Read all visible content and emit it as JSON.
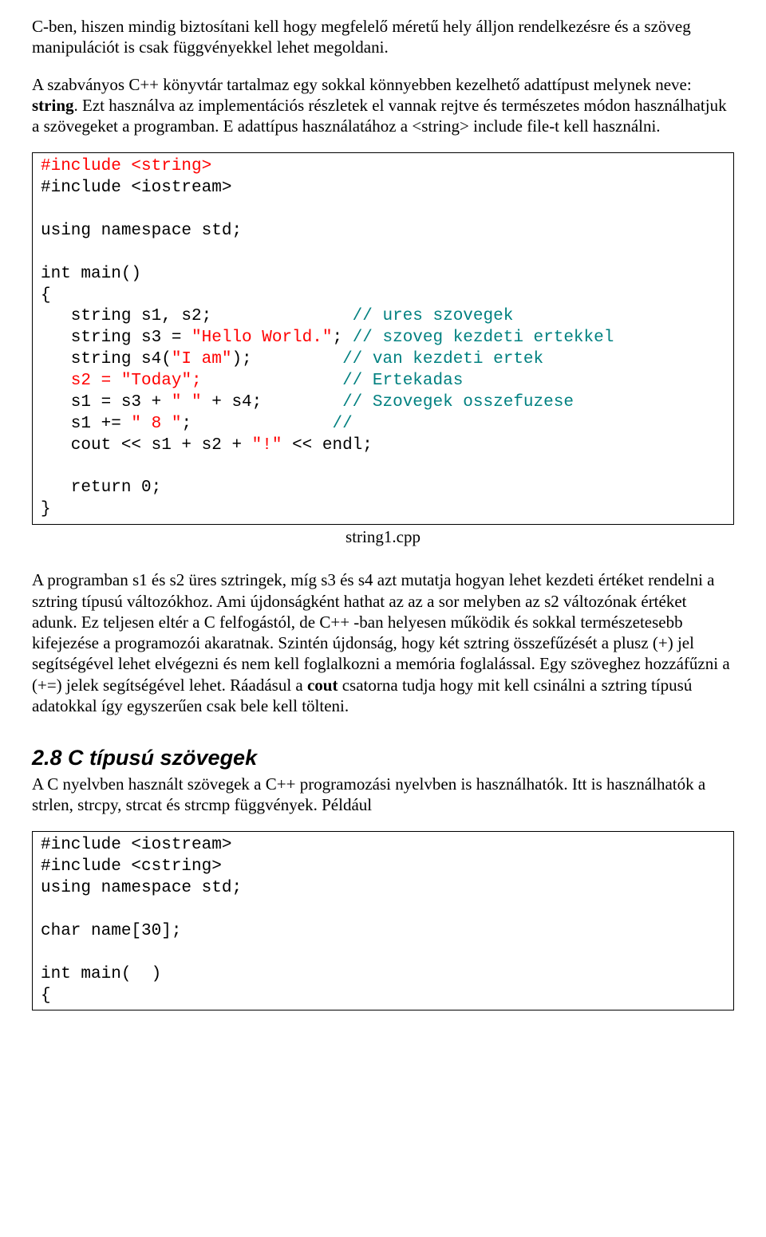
{
  "para1": "C-ben, hiszen mindig biztosítani kell hogy megfelelő méretű hely álljon rendelkezésre és a szöveg manipulációt is csak függvényekkel lehet megoldani.",
  "para2_a": "A szabványos C++ könyvtár tartalmaz egy sokkal könnyebben kezelhető adattípust melynek neve: ",
  "para2_bold": "string",
  "para2_b": ". Ezt használva az implementációs részletek el vannak rejtve és természetes módon használhatjuk a szövegeket a programban. E adattípus használatához a <string> include file-t kell használni.",
  "caption1": "string1.cpp",
  "para3_a": "A programban s1 és s2 üres sztringek, míg s3 és s4 azt mutatja hogyan lehet kezdeti értéket rendelni a sztring típusú változókhoz. Ami újdonságként hathat az az a sor melyben az s2 változónak értéket adunk. Ez teljesen eltér a C felfogástól, de C++ -ban helyesen működik és sokkal természetesebb kifejezése a programozói akaratnak. Szintén újdonság, hogy két sztring összefűzését a plusz (+) jel segítségével lehet elvégezni és nem kell foglalkozni a memória foglalással. Egy szöveghez hozzáfűzni a (+=) jelek segítségével lehet. Ráadásul a ",
  "para3_bold": "cout",
  "para3_b": " csatorna tudja hogy mit kell csinálni a sztring típusú adatokkal így egyszerűen csak bele kell tölteni.",
  "section_title": "2.8 C típusú szövegek",
  "para4": "A C nyelvben használt szövegek a C++ programozási nyelvben is használhatók. Itt is használhatók a strlen, strcpy, strcat és strcmp függvények. Például",
  "code1": {
    "l1": "#include <string>",
    "l2": "#include <iostream>",
    "blank1": "",
    "l3": "using namespace std;",
    "blank2": "",
    "l4": "int main()",
    "l5": "{",
    "l6a": "   string s1, s2;              ",
    "l6b": "// ures szovegek",
    "l7a": "   string s3 = ",
    "l7b": "\"Hello World.\"",
    "l7c": "; ",
    "l7d": "// szoveg kezdeti ertekkel",
    "l8a": "   string s4(",
    "l8b": "\"I am\"",
    "l8c": ");         ",
    "l8d": "// van kezdeti ertek",
    "l9a": "   s2 = ",
    "l9b": "\"Today\"",
    "l9c": ";              ",
    "l9d": "// Ertekadas",
    "l10a": "   s1 = s3 + ",
    "l10b": "\" \"",
    "l10c": " + s4;        ",
    "l10d": "// Szovegek osszefuzese",
    "l11a": "   s1 += ",
    "l11b": "\" 8 \"",
    "l11c": ";              ",
    "l11d": "//",
    "l12a": "   cout << s1 + s2 + ",
    "l12b": "\"!\"",
    "l12c": " << endl;",
    "blank3": "",
    "l13": "   return 0;",
    "l14": "}"
  },
  "code2": {
    "l1": "#include <iostream>",
    "l2": "#include <cstring>",
    "l3": "using namespace std;",
    "blank1": "",
    "l4": "char name[30];",
    "blank2": "",
    "l5": "int main(  )",
    "l6": "{"
  }
}
